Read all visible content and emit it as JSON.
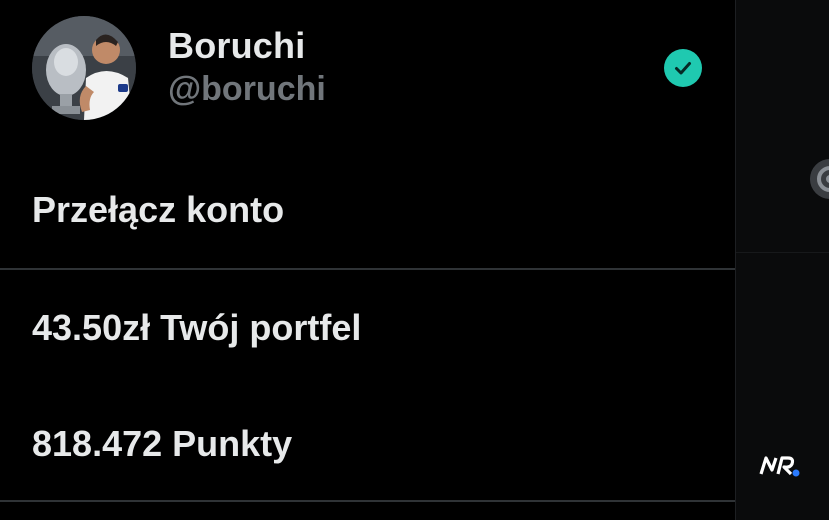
{
  "profile": {
    "display_name": "Boruchi",
    "handle": "@boruchi",
    "avatar_icon": "user-avatar-photo",
    "verified_icon": "check-circle-icon",
    "verified_color": "#1fc9b0"
  },
  "menu": {
    "switch_account": "Przełącz konto",
    "wallet": {
      "label": "43.50zł Twój portfel"
    },
    "points": {
      "label": "818.472 Punkty"
    }
  },
  "side_strip": {
    "icon": "settings-gear-icon",
    "logo_text": "NR"
  },
  "colors": {
    "background": "#000000",
    "primary_text": "#e7e9ea",
    "secondary_text": "#71767b",
    "divider": "#2f3336",
    "accent": "#1fc9b0"
  }
}
